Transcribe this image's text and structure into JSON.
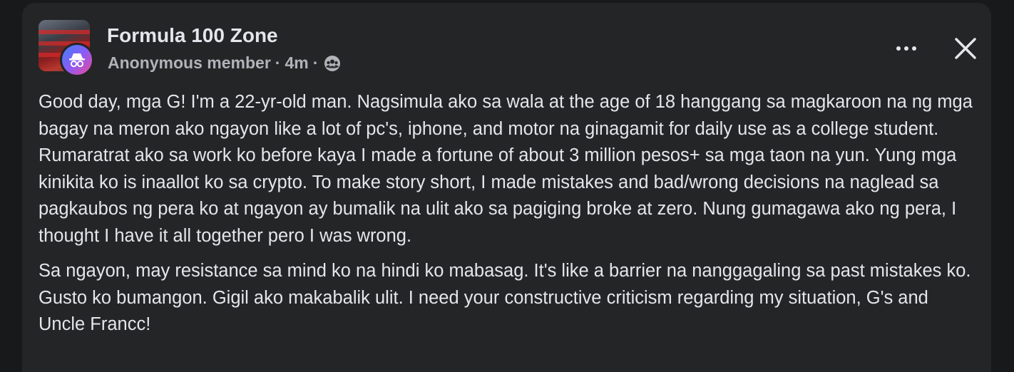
{
  "post": {
    "group_name": "Formula 100 Zone",
    "author": "Anonymous member",
    "separator": "·",
    "time": "4m",
    "audience_icon": "group-audience-icon",
    "avatar_icon": "anonymous-incognito-icon",
    "more_icon": "more-options-icon",
    "close_icon": "close-icon",
    "paragraphs": [
      "Good day, mga G! I'm a 22-yr-old man. Nagsimula ako sa wala at the age of 18 hanggang sa magkaroon na ng mga bagay na meron ako ngayon like a lot of pc's, iphone, and motor na ginagamit for daily use as a college student. Rumaratrat ako sa work ko before kaya I made a fortune of about 3 million pesos+ sa mga taon na yun. Yung mga kinikita ko is inaallot ko sa crypto. To make story short, I made mistakes and bad/wrong decisions na naglead sa pagkaubos ng pera ko at ngayon ay bumalik na ulit ako sa pagiging broke at zero. Nung gumagawa ako ng pera, I thought I have it all together pero I was wrong.",
      "Sa ngayon, may resistance sa mind ko na hindi ko mabasag. It's like a barrier na nanggagaling sa past mistakes ko. Gusto ko bumangon. Gigil ako makabalik ulit. I need your constructive criticism regarding my situation, G's and Uncle Francc!"
    ]
  },
  "colors": {
    "page_background": "#18191a",
    "card_background": "#242526",
    "primary_text": "#e4e6eb",
    "secondary_text": "#b0b3b8"
  }
}
